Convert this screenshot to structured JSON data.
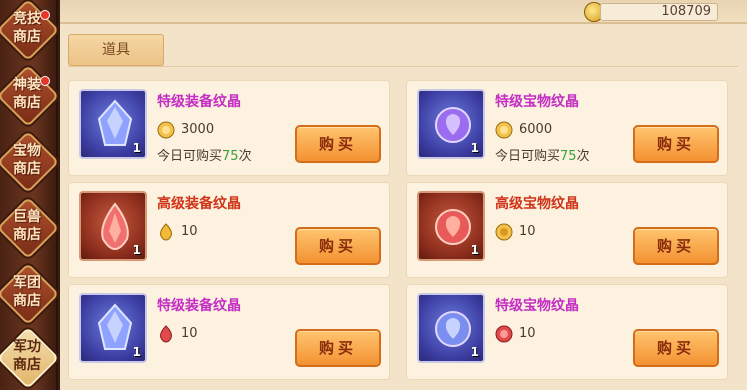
{
  "currency": {
    "gold": "108709"
  },
  "tab": {
    "label": "道具"
  },
  "sidebar": {
    "items": [
      {
        "label": "竞技商店",
        "line1": "竞技",
        "line2": "商店",
        "badge": true
      },
      {
        "label": "神装商店",
        "line1": "神装",
        "line2": "商店",
        "badge": true
      },
      {
        "label": "宝物商店",
        "line1": "宝物",
        "line2": "商店",
        "badge": false
      },
      {
        "label": "巨兽商店",
        "line1": "巨兽",
        "line2": "商店",
        "badge": false
      },
      {
        "label": "军团商店",
        "line1": "军团",
        "line2": "商店",
        "badge": false
      },
      {
        "label": "军功商店",
        "line1": "军功",
        "line2": "商店",
        "badge": false,
        "active": true
      }
    ]
  },
  "items": [
    {
      "name": "特级装备纹晶",
      "rarity": "purple",
      "qty": "1",
      "price": "3000",
      "price_icon": "gold-coin-icon",
      "limit_prefix": "今日可购买",
      "limit_num": "75",
      "limit_suffix": "次",
      "buy": "购买"
    },
    {
      "name": "特级宝物纹晶",
      "rarity": "purple",
      "qty": "1",
      "price": "6000",
      "price_icon": "gold-coin-icon",
      "limit_prefix": "今日可购买",
      "limit_num": "75",
      "limit_suffix": "次",
      "buy": "购买"
    },
    {
      "name": "高级装备纹晶",
      "rarity": "red",
      "qty": "1",
      "price": "10",
      "price_icon": "gold-gem-icon",
      "buy": "购买"
    },
    {
      "name": "高级宝物纹晶",
      "rarity": "red",
      "qty": "1",
      "price": "10",
      "price_icon": "gold-medal-icon",
      "buy": "购买"
    },
    {
      "name": "特级装备纹晶",
      "rarity": "purple",
      "qty": "1",
      "price": "10",
      "price_icon": "red-gem-icon",
      "buy": "购买"
    },
    {
      "name": "特级宝物纹晶",
      "rarity": "purple",
      "qty": "1",
      "price": "10",
      "price_icon": "red-gem-icon",
      "buy": "购买"
    }
  ],
  "colors": {
    "purple_name": "#c42ec4",
    "red_name": "#d03418",
    "limit_num": "#3aa03a",
    "buy_button": "#f39232"
  }
}
